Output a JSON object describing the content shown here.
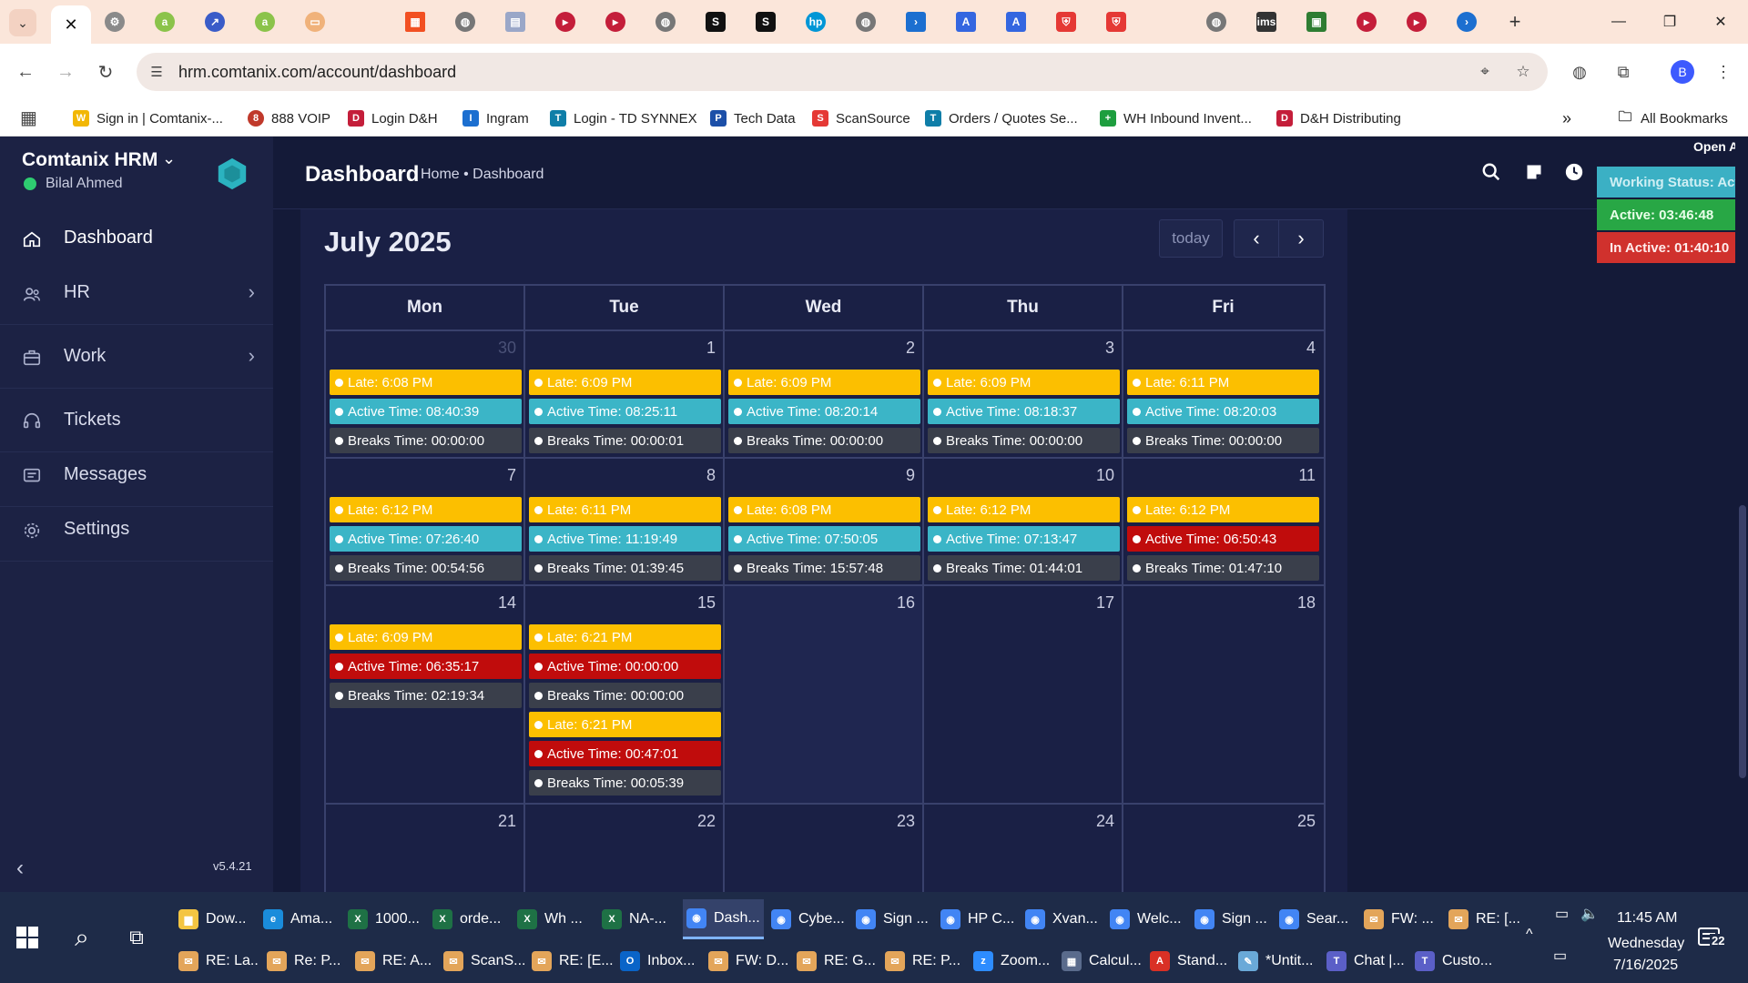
{
  "browser": {
    "url": "hrm.comtanix.com/account/dashboard",
    "bookmarks": [
      "Sign in | Comtanix-...",
      "888 VOIP",
      "Login D&H",
      "Ingram",
      "Login - TD SYNNEX",
      "Tech Data",
      "ScanSource",
      "Orders / Quotes Se...",
      "WH Inbound Invent...",
      "D&H Distributing"
    ],
    "all_bookmarks": "All Bookmarks",
    "profile_initial": "B",
    "overflow": "»"
  },
  "app": {
    "brand": "Comtanix HRM",
    "user": "Bilal Ahmed",
    "version": "v5.4.21",
    "nav": [
      {
        "label": "Dashboard"
      },
      {
        "label": "HR"
      },
      {
        "label": "Work"
      },
      {
        "label": "Tickets"
      },
      {
        "label": "Messages"
      },
      {
        "label": "Settings"
      }
    ]
  },
  "header": {
    "title": "Dashboard",
    "breadcrumb": "Home • Dashboard"
  },
  "status_widget": {
    "open_app": "Open Ap",
    "working": "Working Status: Activ",
    "active": "Active: 03:46:48",
    "inactive": "In Active: 01:40:10"
  },
  "calendar": {
    "title": "July 2025",
    "today_label": "today",
    "prev": "‹",
    "next": "›",
    "weekdays": [
      "Mon",
      "Tue",
      "Wed",
      "Thu",
      "Fri"
    ],
    "weeks": [
      {
        "days": [
          {
            "num": "30",
            "events": [
              {
                "type": "late",
                "text": "Late: 6:08 PM"
              },
              {
                "type": "active-ok",
                "text": "Active Time: 08:40:39"
              },
              {
                "type": "breaks",
                "text": "Breaks Time: 00:00:00"
              }
            ]
          },
          {
            "num": "1",
            "events": [
              {
                "type": "late",
                "text": "Late: 6:09 PM"
              },
              {
                "type": "active-ok",
                "text": "Active Time: 08:25:11"
              },
              {
                "type": "breaks",
                "text": "Breaks Time: 00:00:01"
              }
            ]
          },
          {
            "num": "2",
            "events": [
              {
                "type": "late",
                "text": "Late: 6:09 PM"
              },
              {
                "type": "active-ok",
                "text": "Active Time: 08:20:14"
              },
              {
                "type": "breaks",
                "text": "Breaks Time: 00:00:00"
              }
            ]
          },
          {
            "num": "3",
            "events": [
              {
                "type": "late",
                "text": "Late: 6:09 PM"
              },
              {
                "type": "active-ok",
                "text": "Active Time: 08:18:37"
              },
              {
                "type": "breaks",
                "text": "Breaks Time: 00:00:00"
              }
            ]
          },
          {
            "num": "4",
            "events": [
              {
                "type": "late",
                "text": "Late: 6:11 PM"
              },
              {
                "type": "active-ok",
                "text": "Active Time: 08:20:03"
              },
              {
                "type": "breaks",
                "text": "Breaks Time: 00:00:00"
              }
            ]
          }
        ]
      },
      {
        "days": [
          {
            "num": "7",
            "events": [
              {
                "type": "late",
                "text": "Late: 6:12 PM"
              },
              {
                "type": "active-ok",
                "text": "Active Time: 07:26:40"
              },
              {
                "type": "breaks",
                "text": "Breaks Time: 00:54:56"
              }
            ]
          },
          {
            "num": "8",
            "events": [
              {
                "type": "late",
                "text": "Late: 6:11 PM"
              },
              {
                "type": "active-ok",
                "text": "Active Time: 11:19:49"
              },
              {
                "type": "breaks",
                "text": "Breaks Time: 01:39:45"
              }
            ]
          },
          {
            "num": "9",
            "events": [
              {
                "type": "late",
                "text": "Late: 6:08 PM"
              },
              {
                "type": "active-ok",
                "text": "Active Time: 07:50:05"
              },
              {
                "type": "breaks",
                "text": "Breaks Time: 15:57:48"
              }
            ]
          },
          {
            "num": "10",
            "events": [
              {
                "type": "late",
                "text": "Late: 6:12 PM"
              },
              {
                "type": "active-ok",
                "text": "Active Time: 07:13:47"
              },
              {
                "type": "breaks",
                "text": "Breaks Time: 01:44:01"
              }
            ]
          },
          {
            "num": "11",
            "events": [
              {
                "type": "late",
                "text": "Late: 6:12 PM"
              },
              {
                "type": "active-low",
                "text": "Active Time: 06:50:43"
              },
              {
                "type": "breaks",
                "text": "Breaks Time: 01:47:10"
              }
            ]
          }
        ]
      },
      {
        "days": [
          {
            "num": "14",
            "events": [
              {
                "type": "late",
                "text": "Late: 6:09 PM"
              },
              {
                "type": "active-low",
                "text": "Active Time: 06:35:17"
              },
              {
                "type": "breaks",
                "text": "Breaks Time: 02:19:34"
              }
            ]
          },
          {
            "num": "15",
            "events": [
              {
                "type": "late",
                "text": "Late: 6:21 PM"
              },
              {
                "type": "active-low",
                "text": "Active Time: 00:00:00"
              },
              {
                "type": "breaks",
                "text": "Breaks Time: 00:00:00"
              },
              {
                "type": "late",
                "text": "Late: 6:21 PM"
              },
              {
                "type": "active-low",
                "text": "Active Time: 00:47:01"
              },
              {
                "type": "breaks",
                "text": "Breaks Time: 00:05:39"
              }
            ]
          },
          {
            "num": "16",
            "today": true,
            "events": []
          },
          {
            "num": "17",
            "events": []
          },
          {
            "num": "18",
            "events": []
          }
        ]
      },
      {
        "days": [
          {
            "num": "21",
            "events": []
          },
          {
            "num": "22",
            "events": []
          },
          {
            "num": "23",
            "events": []
          },
          {
            "num": "24",
            "events": []
          },
          {
            "num": "25",
            "events": []
          }
        ]
      }
    ]
  },
  "taskbar": {
    "row1": [
      {
        "label": "Dow...",
        "icon": "folder-icon",
        "color": "#f4c542"
      },
      {
        "label": "Ama...",
        "icon": "edge-icon",
        "color": "#1a8cdb"
      },
      {
        "label": "1000...",
        "icon": "excel-icon",
        "color": "#1e7145"
      },
      {
        "label": "orde...",
        "icon": "excel-icon",
        "color": "#1e7145"
      },
      {
        "label": "Wh ...",
        "icon": "excel-icon",
        "color": "#1e7145"
      },
      {
        "label": "NA-...",
        "icon": "excel-icon",
        "color": "#1e7145"
      },
      {
        "label": "Dash...",
        "icon": "chrome-icon",
        "color": "#4285f4",
        "selected": true
      },
      {
        "label": "Cybe...",
        "icon": "chrome-icon",
        "color": "#4285f4"
      },
      {
        "label": "Sign ...",
        "icon": "chrome-icon",
        "color": "#4285f4"
      },
      {
        "label": "HP C...",
        "icon": "chrome-icon",
        "color": "#4285f4"
      },
      {
        "label": "Xvan...",
        "icon": "chrome-icon",
        "color": "#4285f4"
      },
      {
        "label": "Welc...",
        "icon": "chrome-icon",
        "color": "#4285f4"
      },
      {
        "label": "Sign ...",
        "icon": "chrome-icon",
        "color": "#4285f4"
      },
      {
        "label": "Sear...",
        "icon": "chrome-icon",
        "color": "#4285f4"
      },
      {
        "label": "FW: ...",
        "icon": "mail-icon",
        "color": "#e3a55a"
      },
      {
        "label": "RE: [...",
        "icon": "mail-icon",
        "color": "#e3a55a"
      }
    ],
    "row2": [
      {
        "label": "RE: La...",
        "icon": "mail-icon",
        "color": "#e3a55a"
      },
      {
        "label": "Re: P...",
        "icon": "mail-icon",
        "color": "#e3a55a"
      },
      {
        "label": "RE: A...",
        "icon": "mail-icon",
        "color": "#e3a55a"
      },
      {
        "label": "ScanS...",
        "icon": "mail-icon",
        "color": "#e3a55a"
      },
      {
        "label": "RE: [E...",
        "icon": "mail-icon",
        "color": "#e3a55a"
      },
      {
        "label": "Inbox...",
        "icon": "outlook-icon",
        "color": "#0a64c8"
      },
      {
        "label": "FW: D...",
        "icon": "mail-icon",
        "color": "#e3a55a"
      },
      {
        "label": "RE: G...",
        "icon": "mail-icon",
        "color": "#e3a55a"
      },
      {
        "label": "RE: P...",
        "icon": "mail-icon",
        "color": "#e3a55a"
      },
      {
        "label": "Zoom...",
        "icon": "zoom-icon",
        "color": "#2d8cff"
      },
      {
        "label": "Calcul...",
        "icon": "calculator-icon",
        "color": "#5a6b8c"
      },
      {
        "label": "Stand...",
        "icon": "pdf-icon",
        "color": "#d93025"
      },
      {
        "label": "*Untit...",
        "icon": "notepad-icon",
        "color": "#6aa9d8"
      },
      {
        "label": "Chat |...",
        "icon": "teams-icon",
        "color": "#5b5fc7"
      },
      {
        "label": "Custo...",
        "icon": "teams-icon",
        "color": "#5b5fc7"
      }
    ],
    "clock_time": "11:45 AM",
    "clock_day": "Wednesday",
    "clock_date": "7/16/2025",
    "notif_count": "22"
  }
}
